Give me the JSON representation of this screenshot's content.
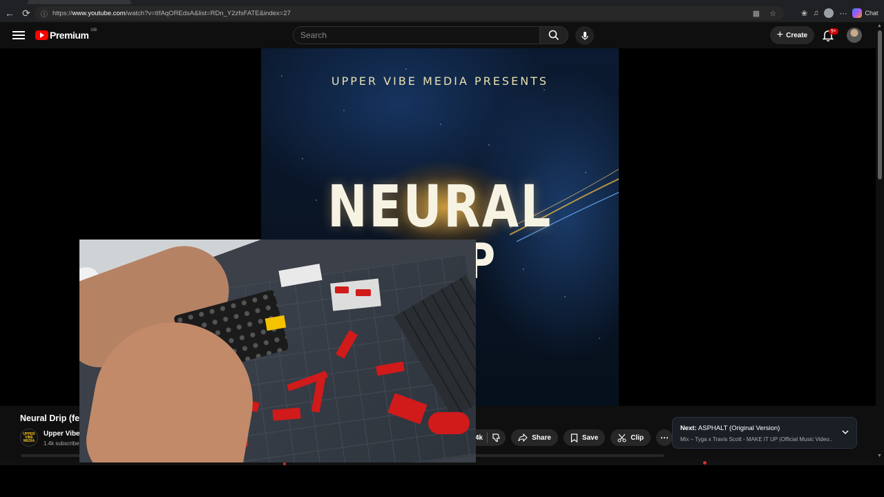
{
  "browser": {
    "url_prefix": "https://",
    "url_host": "www.youtube.com",
    "url_path": "/watch?v=tIfAqOREdsA&list=RDn_Y2zfsFATE&index=27",
    "chat_label": "Chat"
  },
  "header": {
    "logo_text": "Premium",
    "country_code": "GB",
    "search_placeholder": "Search",
    "create_label": "Create",
    "notification_count": "9+"
  },
  "video": {
    "presents_text": "UPPER VIBE MEDIA PRESENTS",
    "title_line1": "NEURAL",
    "title_line2": "DRIP",
    "page_title": "Neural Drip (fe",
    "channel_name": "Upper Vibe",
    "channel_logo_text": "UPPER VIBE MEDIA",
    "subscribers": "1.4k subscribe"
  },
  "actions": {
    "like_count": "4k",
    "share_label": "Share",
    "save_label": "Save",
    "clip_label": "Clip"
  },
  "next_up": {
    "prefix": "Next:",
    "title": "ASPHALT (Original Version)",
    "subtitle": "Mix – Tyga x Travis Scott - MAKE IT UP (Official Music Video..."
  },
  "colors": {
    "brand_red": "#ff0000",
    "badge_red": "#cc0000",
    "background": "#0f0f0f"
  }
}
